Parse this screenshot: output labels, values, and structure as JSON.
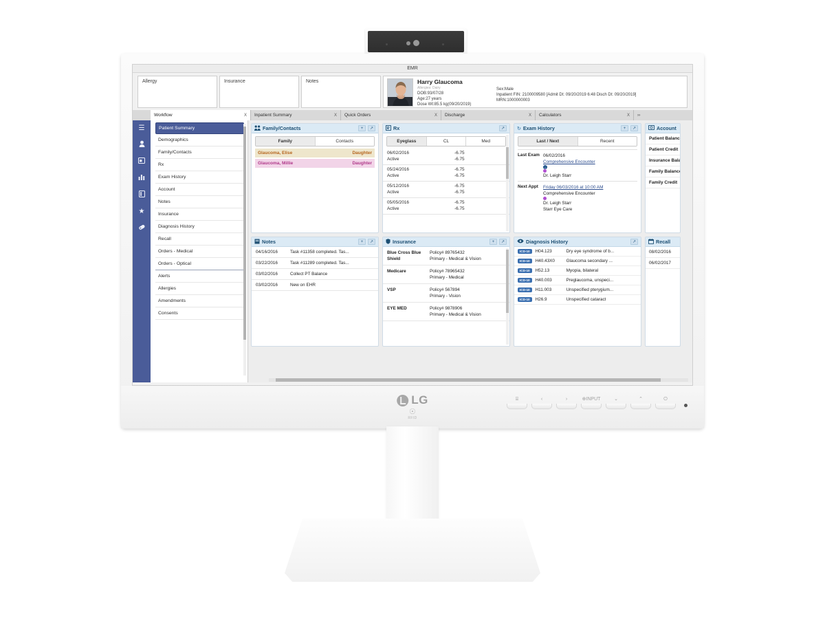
{
  "device": {
    "brand": "LG",
    "rfid_label": "RFID",
    "osd_buttons": [
      {
        "name": "menu",
        "glyph": "⌸"
      },
      {
        "name": "left",
        "glyph": "‹"
      },
      {
        "name": "right",
        "glyph": "›"
      },
      {
        "name": "input",
        "glyph": "⊕INPUT"
      },
      {
        "name": "down",
        "glyph": "⌄"
      },
      {
        "name": "up",
        "glyph": "⌃"
      },
      {
        "name": "power",
        "glyph": "⏻"
      }
    ]
  },
  "app": {
    "window_title": "EMR",
    "header_boxes": [
      {
        "label": "Allergy"
      },
      {
        "label": "Insurance"
      },
      {
        "label": "Notes"
      }
    ],
    "patient": {
      "name": "Harry Glaucoma",
      "allergies": "Allergies: Dairy",
      "dob": "DOB:93/07/28",
      "age": "Age:27 years",
      "dose_weight": "Dose Wt:85.5 kg(09/20/2019)",
      "sex": "Sex:Male",
      "encounter": "Inpatient FIN: 2100009580 [Admit Dt: 09/20/2019 6:48 Disch Dt: 09/20/2019]",
      "mrn": "MRN:1000000003"
    },
    "tabs": [
      {
        "label": "Workflow",
        "close": "X",
        "active": true
      },
      {
        "label": "Inpatient Summary",
        "close": "X",
        "active": false
      },
      {
        "label": "Quick Orders",
        "close": "X",
        "active": false
      },
      {
        "label": "Discharge",
        "close": "X",
        "active": false
      },
      {
        "label": "Calculators",
        "close": "X",
        "active": false
      }
    ],
    "tabs_overflow": "››",
    "iconbar": [
      {
        "name": "hamburger-icon",
        "glyph": "☰"
      },
      {
        "name": "person-icon",
        "glyph": "●"
      },
      {
        "name": "card-icon",
        "glyph": "▣"
      },
      {
        "name": "chart-icon",
        "glyph": "█"
      },
      {
        "name": "book-icon",
        "glyph": "□"
      },
      {
        "name": "star-icon",
        "glyph": "★"
      },
      {
        "name": "pill-icon",
        "glyph": "●"
      }
    ],
    "workflow": {
      "items": [
        {
          "label": "Patient Summary",
          "active": true
        },
        {
          "label": "Demographics",
          "active": false
        },
        {
          "label": "Family/Contacts",
          "active": false
        },
        {
          "label": "Rx",
          "active": false
        },
        {
          "label": "Exam History",
          "active": false
        },
        {
          "label": "Account",
          "active": false
        },
        {
          "label": "Notes",
          "active": false
        },
        {
          "label": "Insurance",
          "active": false
        },
        {
          "label": "Diagnosis History",
          "active": false
        },
        {
          "label": "Recall",
          "active": false
        },
        {
          "label": "Orders - Medical",
          "active": false
        },
        {
          "label": "Orders - Optical",
          "active": false,
          "separator": true
        },
        {
          "label": "Alerts",
          "active": false
        },
        {
          "label": "Allergies",
          "active": false
        },
        {
          "label": "Amendments",
          "active": false
        },
        {
          "label": "Consents",
          "active": false
        }
      ]
    },
    "cards": {
      "family": {
        "title": "Family/Contacts",
        "icon": "people-icon",
        "add": "+",
        "expand": "↗",
        "tabs": [
          {
            "label": "Family",
            "on": true
          },
          {
            "label": "Contacts",
            "on": false
          }
        ],
        "rows": [
          {
            "name": "Glaucoma, Elise",
            "relation": "Daughter"
          },
          {
            "name": "Glaucoma, Millie",
            "relation": "Daughter"
          }
        ]
      },
      "rx": {
        "title": "Rx",
        "icon": "prescription-icon",
        "expand": "↗",
        "tabs": [
          {
            "label": "Eyeglass",
            "on": true
          },
          {
            "label": "CL",
            "on": false
          },
          {
            "label": "Med",
            "on": false
          }
        ],
        "rows": [
          {
            "date": "06/02/2016",
            "status": "Active",
            "od": "-6.75",
            "os": "-6.75"
          },
          {
            "date": "05/24/2016",
            "status": "Active",
            "od": "-6.75",
            "os": "-6.75"
          },
          {
            "date": "05/12/2016",
            "status": "Active",
            "od": "-6.75",
            "os": "-6.75"
          },
          {
            "date": "05/05/2016",
            "status": "Active",
            "od": "-6.75",
            "os": "-6.75"
          }
        ]
      },
      "exam": {
        "title": "Exam History",
        "icon": "history-icon",
        "add": "+",
        "expand": "↗",
        "tabs": [
          {
            "label": "Last / Next",
            "on": true
          },
          {
            "label": "Recent",
            "on": false
          }
        ],
        "last_label": "Last Exam",
        "last_date": "06/02/2016",
        "last_type": "Comprehensive Encounter",
        "last_provider": "Dr. Leigh Starr",
        "next_label": "Next Appt",
        "next_datetime": "Friday 06/03/2016 at 10:00 AM",
        "next_type": "Comprehensive Encounter",
        "next_provider": "Dr. Leigh Starr",
        "next_location": "Starr Eye Care"
      },
      "account": {
        "title": "Account",
        "icon": "money-icon",
        "rows": [
          "Patient Balance",
          "Patient Credit",
          "Insurance Balance",
          "Family Balance",
          "Family Credit"
        ]
      },
      "notes": {
        "title": "Notes",
        "icon": "note-icon",
        "add": "+",
        "expand": "↗",
        "rows": [
          {
            "date": "04/16/2016",
            "text": "Task #11358 completed. Tas..."
          },
          {
            "date": "03/22/2016",
            "text": "Task #11289 completed. Tas..."
          },
          {
            "date": "03/02/2016",
            "text": "Collect PT Balance"
          },
          {
            "date": "03/02/2016",
            "text": "New on EHR"
          }
        ]
      },
      "insurance": {
        "title": "Insurance",
        "icon": "shield-icon",
        "add": "+",
        "expand": "↗",
        "rows": [
          {
            "name": "Blue Cross Blue Shield",
            "policy": "Policy# 89765432",
            "plan": "Primary - Medical & Vision"
          },
          {
            "name": "Medicare",
            "policy": "Policy# 78965432",
            "plan": "Primary - Medical"
          },
          {
            "name": "VSP",
            "policy": "Policy# 567894",
            "plan": "Primary - Vision"
          },
          {
            "name": "EYE MED",
            "policy": "Policy# 9878906",
            "plan": "Primary - Medical & Vision"
          }
        ]
      },
      "diagnosis": {
        "title": "Diagnosis History",
        "icon": "eye-icon",
        "expand": "↗",
        "badge": "ICD-10",
        "rows": [
          {
            "code": "H04.123",
            "desc": "Dry eye syndrome of b..."
          },
          {
            "code": "H40.43X0",
            "desc": "Glaucoma secondary ..."
          },
          {
            "code": "H52.13",
            "desc": "Myopia, bilateral"
          },
          {
            "code": "H40.003",
            "desc": "Preglaucoma, unspeci..."
          },
          {
            "code": "H11.003",
            "desc": "Unspecified pterygium..."
          },
          {
            "code": "H26.9",
            "desc": "Unspecified cataract"
          }
        ]
      },
      "recall": {
        "title": "Recall",
        "icon": "calendar-icon",
        "rows": [
          "08/02/2016",
          "06/02/2017"
        ]
      }
    }
  }
}
